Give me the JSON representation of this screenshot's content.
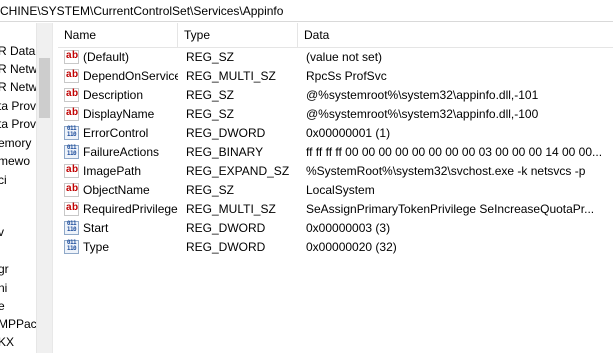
{
  "address_bar": {
    "path": "CHINE\\SYSTEM\\CurrentControlSet\\Services\\Appinfo"
  },
  "tree": {
    "items": [
      "R Data",
      "R Netw",
      "R Netw",
      "ta Prov",
      "ta Prov",
      "emory",
      "mewo",
      "ci",
      "",
      "v",
      "",
      "",
      "gr",
      "ni",
      "e",
      "MPPack",
      "KX"
    ]
  },
  "columns": {
    "name": "Name",
    "type": "Type",
    "data": "Data"
  },
  "icon_glyphs": {
    "string": {
      "a": "a",
      "b": "b"
    },
    "binary": {
      "top": "011",
      "bottom": "110"
    }
  },
  "values": [
    {
      "name": "(Default)",
      "type": "REG_SZ",
      "data": "(value not set)",
      "icon": "string-value-icon"
    },
    {
      "name": "DependOnService",
      "type": "REG_MULTI_SZ",
      "data": "RpcSs ProfSvc",
      "icon": "string-value-icon"
    },
    {
      "name": "Description",
      "type": "REG_SZ",
      "data": "@%systemroot%\\system32\\appinfo.dll,-101",
      "icon": "string-value-icon"
    },
    {
      "name": "DisplayName",
      "type": "REG_SZ",
      "data": "@%systemroot%\\system32\\appinfo.dll,-100",
      "icon": "string-value-icon"
    },
    {
      "name": "ErrorControl",
      "type": "REG_DWORD",
      "data": "0x00000001 (1)",
      "icon": "binary-value-icon"
    },
    {
      "name": "FailureActions",
      "type": "REG_BINARY",
      "data": "ff ff ff ff 00 00 00 00 00 00 00 00 03 00 00 00 14 00 00...",
      "icon": "binary-value-icon"
    },
    {
      "name": "ImagePath",
      "type": "REG_EXPAND_SZ",
      "data": "%SystemRoot%\\system32\\svchost.exe -k netsvcs -p",
      "icon": "string-value-icon"
    },
    {
      "name": "ObjectName",
      "type": "REG_SZ",
      "data": "LocalSystem",
      "icon": "string-value-icon"
    },
    {
      "name": "RequiredPrivilege...",
      "type": "REG_MULTI_SZ",
      "data": "SeAssignPrimaryTokenPrivilege SeIncreaseQuotaPr...",
      "icon": "string-value-icon"
    },
    {
      "name": "Start",
      "type": "REG_DWORD",
      "data": "0x00000003 (3)",
      "icon": "binary-value-icon"
    },
    {
      "name": "Type",
      "type": "REG_DWORD",
      "data": "0x00000020 (32)",
      "icon": "binary-value-icon"
    }
  ],
  "colors": {
    "string_icon": "#c00000",
    "binary_icon": "#1f4e9c"
  }
}
